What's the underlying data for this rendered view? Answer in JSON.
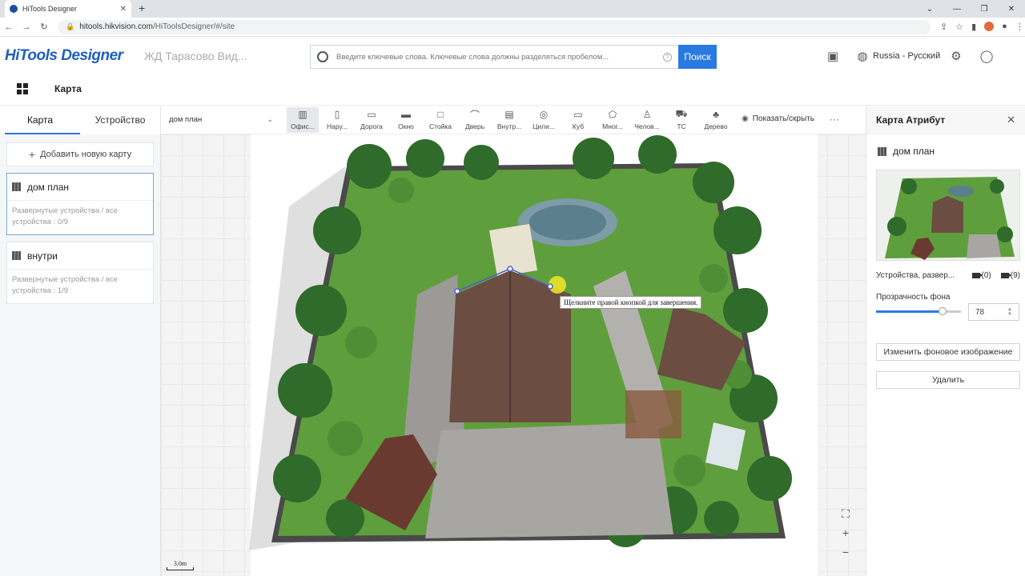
{
  "browser": {
    "tab_title": "HiTools Designer",
    "url_domain": "hitools.hikvision.com",
    "url_path": "/HiToolsDesigner/#/site"
  },
  "header": {
    "logo": "HiTools Designer",
    "project_name": "ЖД Тарасово Вид...",
    "search_placeholder": "Введите ключевые слова. Ключевые слова должны разделяться пробелом...",
    "search_button": "Поиск",
    "language": "Russia - Русский"
  },
  "subheader": {
    "title": "Карта"
  },
  "left_panel": {
    "tabs": [
      {
        "label": "Карта"
      },
      {
        "label": "Устройство"
      }
    ],
    "add_map": "Добавить новую карту",
    "maps": [
      {
        "name": "дом план",
        "subtitle": "Развернутые устройства / все устройства : 0/9"
      },
      {
        "name": "внутри",
        "subtitle": "Развернутые устройства / все устройства : 1/9"
      }
    ]
  },
  "toolbar": {
    "map_select": "дом план",
    "tools": [
      {
        "label": "Офис..."
      },
      {
        "label": "Нару..."
      },
      {
        "label": "Дорога"
      },
      {
        "label": "Окно"
      },
      {
        "label": "Стойка"
      },
      {
        "label": "Дверь"
      },
      {
        "label": "Внутр..."
      },
      {
        "label": "Цили..."
      },
      {
        "label": "Куб"
      },
      {
        "label": "Мног..."
      },
      {
        "label": "Челов..."
      },
      {
        "label": "ТС"
      },
      {
        "label": "Дерево"
      }
    ],
    "show_hide": "Показать/скрыть"
  },
  "canvas": {
    "tooltip": "Щелкните правой кнопкой для завершения.",
    "scale": "3.0m"
  },
  "right_panel": {
    "title": "Карта Атрибут",
    "map_name": "дом план",
    "devices_label": "Устройства, развер...",
    "cam_count_a": "(0)",
    "cam_count_b": "(9)",
    "opacity_label": "Прозрачность фона",
    "opacity_value": "78",
    "change_bg": "Изменить фоновое изображение",
    "delete": "Удалить"
  },
  "colors": {
    "accent": "#2a7ae2",
    "grass": "#5f9e3c",
    "roof": "#6b4d42"
  }
}
